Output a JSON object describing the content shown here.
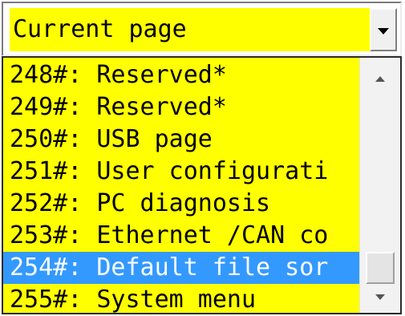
{
  "combo": {
    "current_value": "Current page",
    "icon": "chevron-down-icon"
  },
  "list": {
    "items": [
      {
        "label": "248#: Reserved*"
      },
      {
        "label": "249#: Reserved*"
      },
      {
        "label": "250#: USB page"
      },
      {
        "label": "251#: User configurati"
      },
      {
        "label": "252#: PC diagnosis"
      },
      {
        "label": "253#: Ethernet /CAN co"
      },
      {
        "label": "254#: Default file sor"
      },
      {
        "label": "255#: System menu"
      }
    ],
    "selected_index": 6
  },
  "scrollbar": {
    "up_icon": "scroll-up-arrow-icon",
    "down_icon": "scroll-down-arrow-icon",
    "position_fraction": 0.97
  },
  "colors": {
    "field_background": "#ffff00",
    "selection": "#3399ff"
  }
}
